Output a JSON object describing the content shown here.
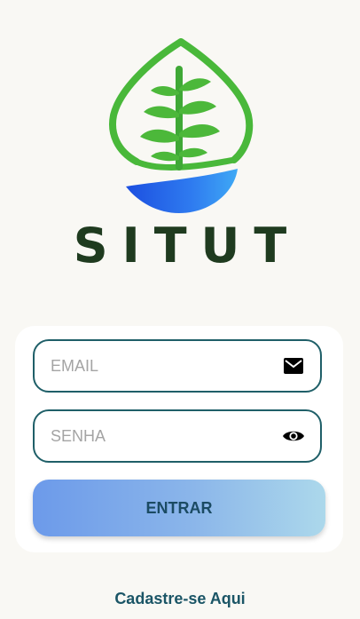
{
  "app": {
    "brand_name": "SITUT"
  },
  "login_form": {
    "email": {
      "placeholder": "EMAIL",
      "value": "",
      "icon": "mail-icon"
    },
    "password": {
      "placeholder": "SENHA",
      "value": "",
      "icon": "eye-icon"
    },
    "submit_label": "ENTRAR"
  },
  "signup_link": "Cadastre-se Aqui",
  "colors": {
    "background": "#f9f8f4",
    "leaf_green": "#4cb83a",
    "water_blue": "#2a64e6",
    "brand_text": "#1f3b1f",
    "field_border": "#1f5f68",
    "button_gradient_start": "#6c9aea",
    "button_gradient_end": "#acd8eb",
    "link_text": "#1b5566"
  }
}
